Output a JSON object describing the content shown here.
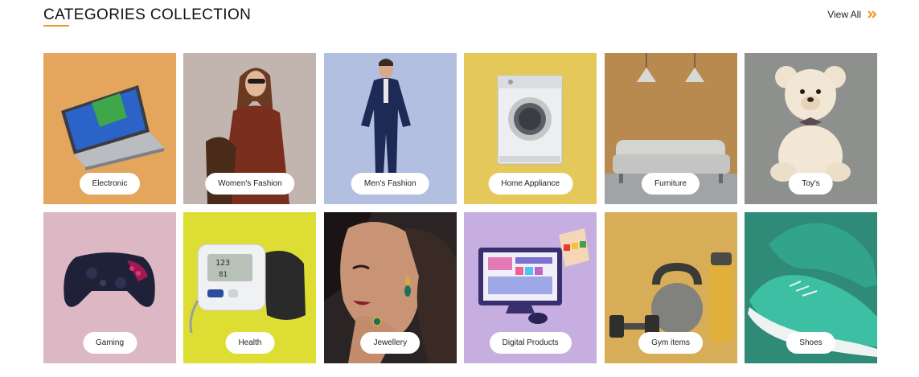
{
  "header": {
    "title": "CATEGORIES COLLECTION",
    "view_all": "View All",
    "accent_color": "#f0941f"
  },
  "categories": [
    {
      "label": "Electronic",
      "bg": "#e3a65c",
      "icon": "laptop-icon"
    },
    {
      "label": "Women's Fashion",
      "bg": "#c2b4ae",
      "icon": "woman-photo-icon"
    },
    {
      "label": "Men's Fashion",
      "bg": "#b2bfe1",
      "icon": "man-photo-icon"
    },
    {
      "label": "Home Appliance",
      "bg": "#e4c95a",
      "icon": "washing-machine-icon"
    },
    {
      "label": "Furniture",
      "bg": "#b98a50",
      "icon": "sofa-icon"
    },
    {
      "label": "Toy's",
      "bg": "#8d908d",
      "icon": "teddy-bear-icon"
    },
    {
      "label": "Gaming",
      "bg": "#dcb7c4",
      "icon": "gamepad-icon"
    },
    {
      "label": "Health",
      "bg": "#dedd33",
      "icon": "blood-pressure-monitor-icon"
    },
    {
      "label": "Jewellery",
      "bg": "#2a2424",
      "icon": "jewellery-model-icon"
    },
    {
      "label": "Digital Products",
      "bg": "#c7aee0",
      "icon": "digital-design-icon"
    },
    {
      "label": "Gym items",
      "bg": "#d8ad57",
      "icon": "kettlebell-icon"
    },
    {
      "label": "Shoes",
      "bg": "#2f8a78",
      "icon": "sneaker-icon"
    }
  ]
}
